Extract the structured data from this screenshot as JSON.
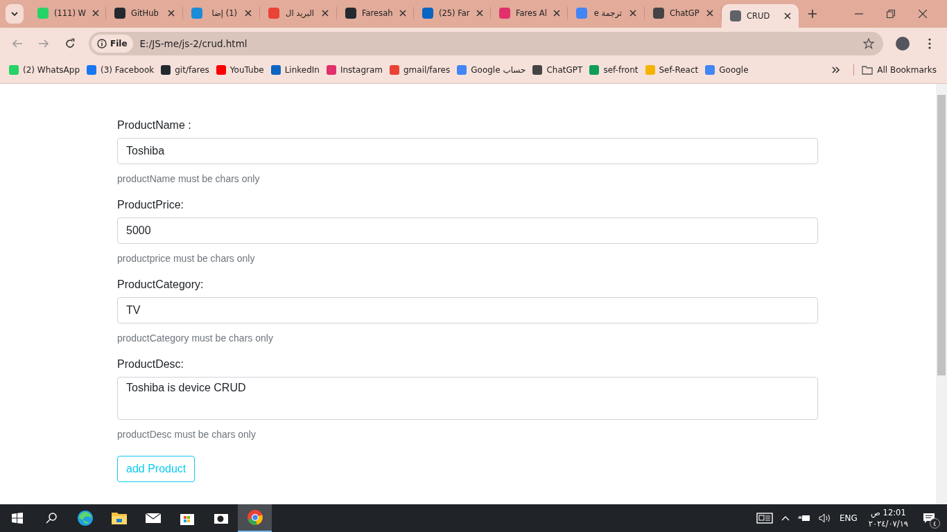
{
  "tabs": [
    {
      "title": "(111) W",
      "color": "#25d366",
      "selected": false
    },
    {
      "title": "GitHub",
      "color": "#24292f",
      "selected": false
    },
    {
      "title": "(1) إضا",
      "color": "#1a8cd8",
      "selected": false
    },
    {
      "title": "البريد ال",
      "color": "#ea4335",
      "selected": false
    },
    {
      "title": "Faresah",
      "color": "#24292f",
      "selected": false
    },
    {
      "title": "(25) Far",
      "color": "#0a66c2",
      "selected": false
    },
    {
      "title": "Fares Al",
      "color": "#e1306c",
      "selected": false
    },
    {
      "title": "ترجمة e",
      "color": "#4285f4",
      "selected": false
    },
    {
      "title": "ChatGP",
      "color": "#444444",
      "selected": false
    },
    {
      "title": "CRUD",
      "color": "#5f6368",
      "selected": true
    }
  ],
  "address": {
    "scheme": "File",
    "url": "E:/JS-me/js-2/crud.html"
  },
  "bookmarks": [
    {
      "label": "(2) WhatsApp",
      "color": "#25d366"
    },
    {
      "label": "(3) Facebook",
      "color": "#1877f2"
    },
    {
      "label": "git/fares",
      "color": "#24292f"
    },
    {
      "label": "YouTube",
      "color": "#ff0000"
    },
    {
      "label": "LinkedIn",
      "color": "#0a66c2"
    },
    {
      "label": "Instagram",
      "color": "#e1306c"
    },
    {
      "label": "gmail/fares",
      "color": "#ea4335"
    },
    {
      "label": "Google حساب",
      "color": "#4285f4"
    },
    {
      "label": "ChatGPT",
      "color": "#444444"
    },
    {
      "label": "sef-front",
      "color": "#0f9d58"
    },
    {
      "label": "Sef-React",
      "color": "#f4b400"
    },
    {
      "label": "Google",
      "color": "#4285f4"
    }
  ],
  "all_bookmarks": "All Bookmarks",
  "form": {
    "fields": [
      {
        "kind": "input",
        "label": "ProductName :",
        "value": "Toshiba",
        "hint": "productName must be chars only"
      },
      {
        "kind": "input",
        "label": "ProductPrice:",
        "value": "5000",
        "hint": "productprice must be chars only"
      },
      {
        "kind": "input",
        "label": "ProductCategory:",
        "value": "TV",
        "hint": "productCategory must be chars only"
      },
      {
        "kind": "textarea",
        "label": "ProductDesc:",
        "value": "Toshiba is device CRUD",
        "hint": "productDesc must be chars only"
      }
    ],
    "button": "add Product"
  },
  "taskbar": {
    "language": "ENG",
    "time": "12:01 ص",
    "date": "٢٠٢٤/٠٧/١٩",
    "notifications": "٤"
  }
}
